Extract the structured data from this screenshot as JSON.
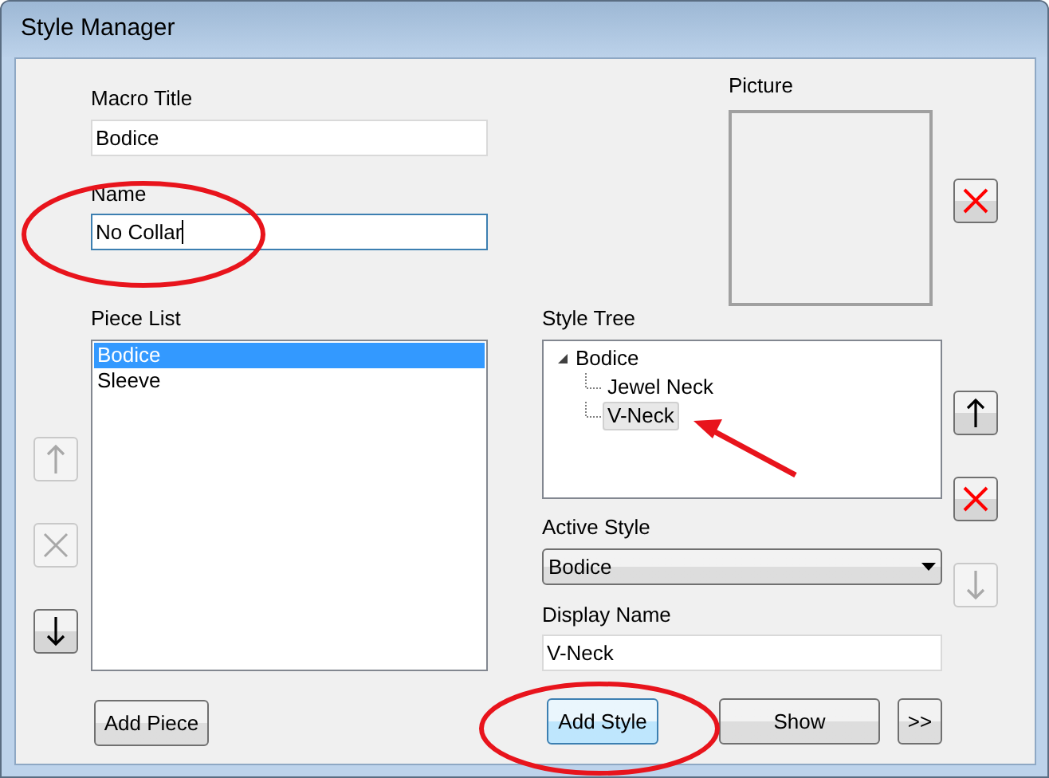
{
  "window": {
    "title": "Style Manager"
  },
  "macro_title": {
    "label": "Macro Title",
    "value": "Bodice",
    "focused": false
  },
  "name": {
    "label": "Name",
    "value": "No Collar",
    "focused": true
  },
  "picture": {
    "label": "Picture",
    "clear_button": {
      "kind": "delete",
      "disabled": false
    }
  },
  "piece_list": {
    "label": "Piece List",
    "items": [
      {
        "text": "Bodice",
        "selected": true
      },
      {
        "text": "Sleeve",
        "selected": false
      }
    ]
  },
  "piece_buttons": [
    {
      "kind": "up",
      "disabled": true
    },
    {
      "kind": "delete",
      "disabled": true
    },
    {
      "kind": "down",
      "disabled": false
    }
  ],
  "style_tree": {
    "label": "Style Tree",
    "items": [
      {
        "text": "Bodice",
        "expanded": true,
        "selected": false,
        "children": [
          {
            "text": "Jewel Neck",
            "selected": false
          },
          {
            "text": "V-Neck",
            "selected": true
          }
        ]
      }
    ]
  },
  "style_buttons": [
    {
      "kind": "up",
      "disabled": false
    },
    {
      "kind": "delete",
      "disabled": false
    },
    {
      "kind": "down",
      "disabled": true
    }
  ],
  "active_style": {
    "label": "Active Style",
    "value": "Bodice"
  },
  "display_name": {
    "label": "Display Name",
    "value": "V-Neck",
    "focused": false
  },
  "bottom_buttons": [
    {
      "label": "Add Piece",
      "highlighted": false
    },
    {
      "label": "Add Style",
      "highlighted": true
    },
    {
      "label": "Show",
      "highlighted": false
    },
    {
      "label": ">>",
      "highlighted": false
    }
  ]
}
